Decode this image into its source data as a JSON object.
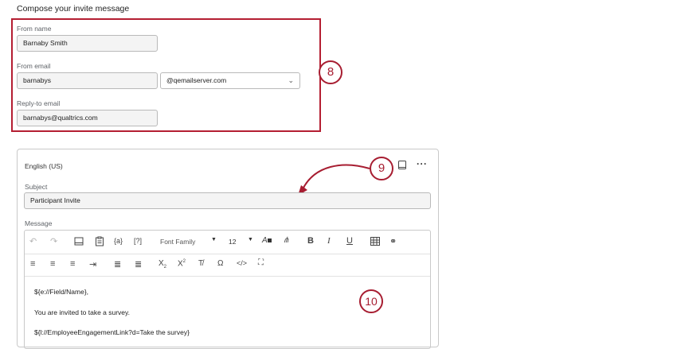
{
  "section_title": "Compose your invite message",
  "from_name": {
    "label": "From name",
    "value": "Barnaby Smith"
  },
  "from_email": {
    "label": "From email",
    "value": "barnabys",
    "domain": "@qemailserver.com"
  },
  "reply_to": {
    "label": "Reply-to email",
    "value": "barnabys@qualtrics.com"
  },
  "callouts": {
    "c8": "8",
    "c9": "9",
    "c10": "10"
  },
  "card": {
    "language": "English (US)",
    "subject_label": "Subject",
    "subject_value": "Participant Invite",
    "message_label": "Message",
    "more_icon": "more-icon",
    "book_icon": "book-icon"
  },
  "toolbar": {
    "font_family": "Font Family",
    "font_size": "12",
    "icons_row1": [
      "undo-icon",
      "redo-icon",
      "layout-icon",
      "clipboard-icon",
      "piped-text-icon",
      "help-text-icon",
      "font-color-icon",
      "highlight-icon",
      "bold-icon",
      "italic-icon",
      "underline-icon",
      "table-icon",
      "link-icon"
    ],
    "icons_row2": [
      "align-left-icon",
      "align-center-icon",
      "align-right-icon",
      "indent-icon",
      "ordered-list-icon",
      "bullet-list-icon",
      "subscript-icon",
      "superscript-icon",
      "clear-format-icon",
      "special-char-icon",
      "source-code-icon",
      "fullscreen-icon"
    ]
  },
  "message_lines": [
    "${e://Field/Name},",
    "You are invited to take a survey.",
    "${l://EmployeeEngagementLink?d=Take the survey}"
  ],
  "colors": {
    "accent": "#a71d31",
    "border": "#c9c9c9"
  }
}
